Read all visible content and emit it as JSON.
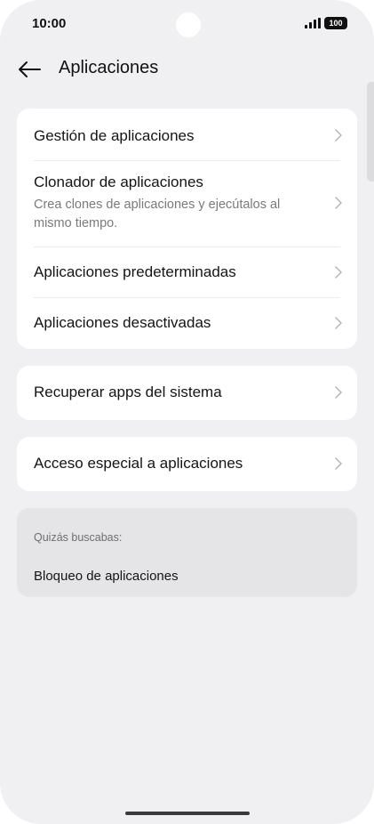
{
  "status_bar": {
    "time": "10:00",
    "battery": "100",
    "signal_icon": "signal-bars-icon"
  },
  "header": {
    "back_icon": "arrow-left-icon",
    "title": "Aplicaciones"
  },
  "main_group": {
    "items": [
      {
        "title": "Gestión de aplicaciones"
      },
      {
        "title": "Clonador de aplicaciones",
        "subtitle": "Crea clones de aplicaciones y ejecútalos al mismo tiempo."
      },
      {
        "title": "Aplicaciones predeterminadas"
      },
      {
        "title": "Aplicaciones desactivadas"
      }
    ]
  },
  "recover_group": {
    "title": "Recuperar apps del sistema"
  },
  "special_group": {
    "title": "Acceso especial a aplicaciones"
  },
  "suggestion": {
    "label": "Quizás buscabas:",
    "link": "Bloqueo de aplicaciones"
  },
  "colors": {
    "background": "#f0f0f2",
    "card": "#ffffff",
    "suggestion_card": "#e5e5e8",
    "secondary_text": "#7a7a7a"
  }
}
